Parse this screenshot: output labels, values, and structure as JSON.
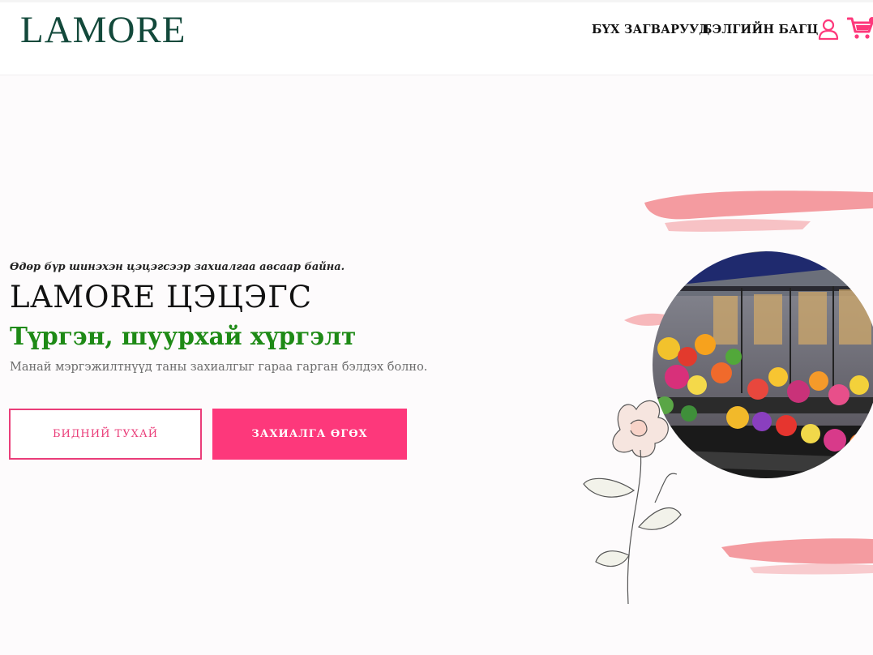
{
  "header": {
    "logo": "LAMORE",
    "nav": [
      "БҮХ ЗАГВАРУУД",
      "БЭЛГИЙН БАГЦ"
    ],
    "icons": [
      "user-icon",
      "cart-icon"
    ]
  },
  "hero": {
    "tagline": "Өдөр бүр шинэхэн цэцэгсээр захиалгаа авсаар байна.",
    "title": "LAMORE ЦЭЦЭГС",
    "subtitle": "Түргэн, шуурхай хүргэлт",
    "description": "Манай мэргэжилтнүүд таны захиалгыг гараа гарган бэлдэх болно.",
    "buttons": {
      "about": "БИДНИЙ ТУХАЙ",
      "order": "ЗАХИАЛГА ӨГӨХ"
    }
  },
  "colors": {
    "accent": "#fd387b",
    "brand": "#13493b",
    "subtitle": "#1e8a16"
  }
}
